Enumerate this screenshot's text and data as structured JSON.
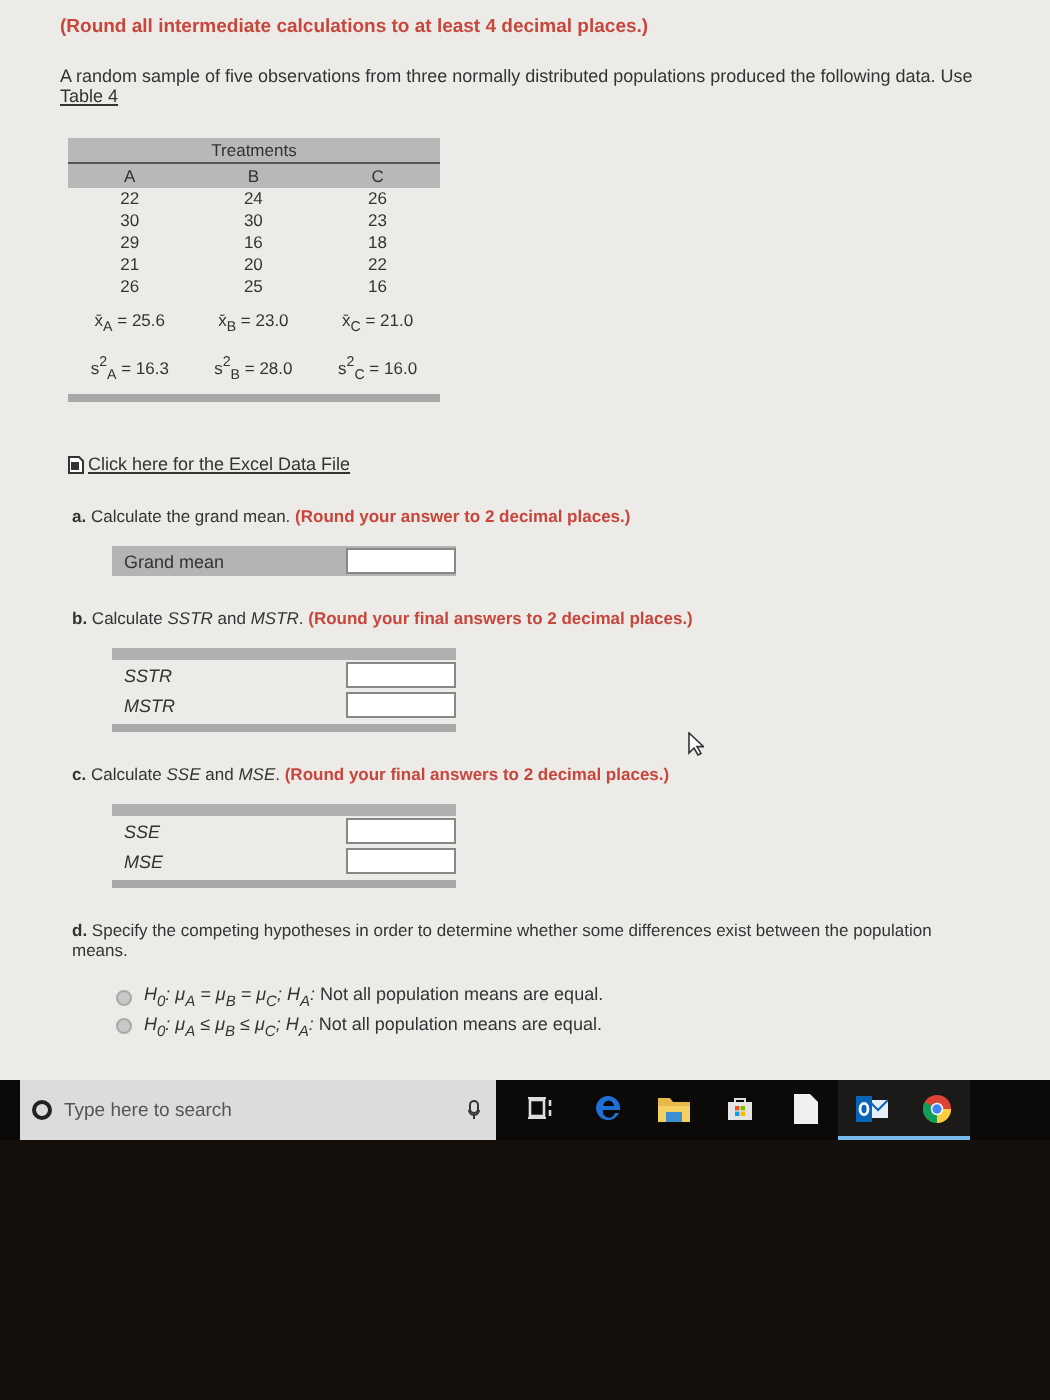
{
  "instruction": "(Round all intermediate calculations to at least 4 decimal places.)",
  "intro": {
    "text": "A random sample of five observations from three normally distributed populations produced the following data. Use",
    "link": "Table 4"
  },
  "table": {
    "title": "Treatments",
    "columns": [
      "A",
      "B",
      "C"
    ],
    "rows": [
      [
        "22",
        "24",
        "26"
      ],
      [
        "30",
        "30",
        "23"
      ],
      [
        "29",
        "16",
        "18"
      ],
      [
        "21",
        "20",
        "22"
      ],
      [
        "26",
        "25",
        "16"
      ]
    ],
    "means": [
      "x̄$_{A}$ = 25.6",
      "x̄$_{B}$ = 23.0",
      "x̄$_{C}$ = 21.0"
    ],
    "variances": [
      "s$^{2}$$_{A}$ = 16.3",
      "s$^{2}$$_{B}$ = 28.0",
      "s$^{2}$$_{C}$ = 16.0"
    ]
  },
  "data_file_link": "Click here for the Excel Data File",
  "parts": [
    {
      "kind": "inputs",
      "letter": "a.",
      "prompt": "Calculate the grand mean.",
      "note": "(Round your answer to 2 decimal places.)",
      "header": false,
      "fields": [
        "Grand mean"
      ]
    },
    {
      "kind": "inputs",
      "letter": "b.",
      "prompt": "Calculate *SSTR* and *MSTR*.",
      "note": "(Round your final answers to 2 decimal places.)",
      "header": true,
      "fields": [
        "SSTR",
        "MSTR"
      ]
    },
    {
      "kind": "inputs",
      "letter": "c.",
      "prompt": "Calculate *SSE* and *MSE*.",
      "note": "(Round your final answers to 2 decimal places.)",
      "header": true,
      "fields": [
        "SSE",
        "MSE"
      ]
    },
    {
      "kind": "choices",
      "letter": "d.",
      "prompt": "Specify the competing hypotheses in order to determine whether some differences exist between the population means.",
      "options": [
        {
          "text": "*H$_{0}$: μ$_{A}$ = μ$_{B}$ = μ$_{C}$; H$_{A}$:* Not all population means are equal.",
          "selected": false
        },
        {
          "text": "*H$_{0}$: μ$_{A}$ ≤ μ$_{B}$ ≤ μ$_{C}$; H$_{A}$:* Not all population means are equal.",
          "selected": false
        }
      ]
    }
  ],
  "taskbar": {
    "search_placeholder": "Type here to search",
    "apps": [
      {
        "kind": "taskview",
        "running": false
      },
      {
        "kind": "edge",
        "running": false
      },
      {
        "kind": "folder",
        "running": false
      },
      {
        "kind": "store",
        "running": false
      },
      {
        "kind": "file",
        "running": false
      },
      {
        "kind": "outlook",
        "running": true
      },
      {
        "kind": "chrome",
        "running": true
      }
    ]
  }
}
